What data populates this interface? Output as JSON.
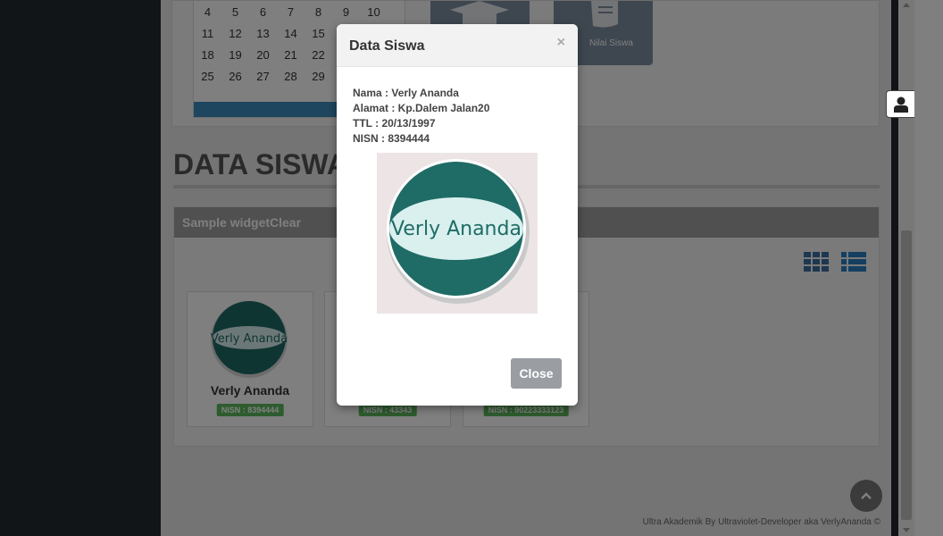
{
  "calendar": {
    "rows": [
      [
        "4",
        "5",
        "6",
        "7",
        "8",
        "9",
        "10"
      ],
      [
        "11",
        "12",
        "13",
        "14",
        "15"
      ],
      [
        "18",
        "19",
        "20",
        "21",
        "22"
      ],
      [
        "25",
        "26",
        "27",
        "28",
        "29"
      ]
    ]
  },
  "tiles": {
    "nilai_label": "Nilai Siswa"
  },
  "section": {
    "title": "DATA SISWA",
    "widget_title": "Sample widgetClear"
  },
  "cards": [
    {
      "name": "Verly Ananda",
      "badge": "NISN : 8394444"
    },
    {
      "name": "",
      "badge": "NISN : 43343"
    },
    {
      "name": "",
      "badge": "NISN : 90223333123"
    }
  ],
  "logo_text": "Verly Ananda",
  "footer": {
    "text": "Ultra Akademik By Ultraviolet-Developer aka VerlyAnanda ©"
  },
  "modal": {
    "title": "Data Siswa",
    "close_x": "×",
    "nama": "Nama : Verly Ananda",
    "alamat": "Alamat : Kp.Dalem Jalan20",
    "ttl": "TTL : 20/13/1997",
    "nisn": "NISN : 8394444",
    "close_label": "Close"
  },
  "colors": {
    "accent": "#3c8dbc",
    "badge": "#5cb85c",
    "logo_teal": "#1f6b66"
  },
  "icons": {
    "user": "user-icon",
    "grid": "grid-view-icon",
    "list": "list-view-icon",
    "up": "chevron-up-icon"
  }
}
